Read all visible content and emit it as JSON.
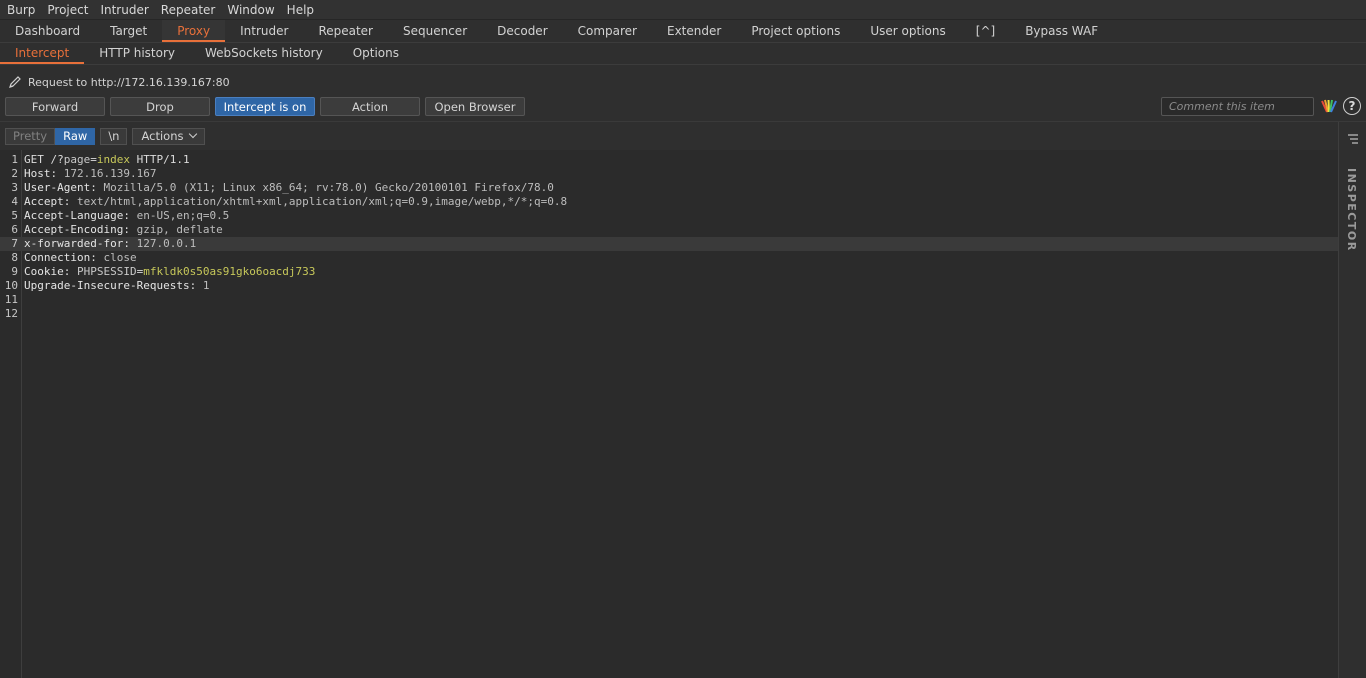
{
  "menubar": [
    "Burp",
    "Project",
    "Intruder",
    "Repeater",
    "Window",
    "Help"
  ],
  "main_tabs": [
    "Dashboard",
    "Target",
    "Proxy",
    "Intruder",
    "Repeater",
    "Sequencer",
    "Decoder",
    "Comparer",
    "Extender",
    "Project options",
    "User options",
    "[^]",
    "Bypass WAF"
  ],
  "active_main_tab": "Proxy",
  "proxy_tabs": [
    "Intercept",
    "HTTP history",
    "WebSockets history",
    "Options"
  ],
  "active_proxy_tab": "Intercept",
  "request_url": "Request to http://172.16.139.167:80",
  "buttons": {
    "forward": "Forward",
    "drop": "Drop",
    "intercept": "Intercept is on",
    "action": "Action",
    "open_browser": "Open Browser"
  },
  "comment_placeholder": "Comment this item",
  "help_glyph": "?",
  "editor_toolbar": {
    "pretty": "Pretty",
    "raw": "Raw",
    "newline": "\\n",
    "actions": "Actions"
  },
  "inspector_label": "INSPECTOR",
  "accent_color": "#e8703a",
  "primary_button_color": "#2f66a6",
  "request_lines": [
    {
      "n": "1",
      "parts": [
        [
          "plain",
          "GET /?"
        ],
        [
          "pname",
          "page"
        ],
        [
          "plain",
          "="
        ],
        [
          "pval",
          "index"
        ],
        [
          "plain",
          " HTTP/1.1"
        ]
      ]
    },
    {
      "n": "2",
      "parts": [
        [
          "hname",
          "Host"
        ],
        [
          "plain",
          ": "
        ],
        [
          "hval",
          "172.16.139.167"
        ]
      ]
    },
    {
      "n": "3",
      "parts": [
        [
          "hname",
          "User-Agent"
        ],
        [
          "plain",
          ": "
        ],
        [
          "hval",
          "Mozilla/5.0 (X11; Linux x86_64; rv:78.0) Gecko/20100101 Firefox/78.0"
        ]
      ]
    },
    {
      "n": "4",
      "parts": [
        [
          "hname",
          "Accept"
        ],
        [
          "plain",
          ": "
        ],
        [
          "hval",
          "text/html,application/xhtml+xml,application/xml;q=0.9,image/webp,*/*;q=0.8"
        ]
      ]
    },
    {
      "n": "5",
      "parts": [
        [
          "hname",
          "Accept-Language"
        ],
        [
          "plain",
          ": "
        ],
        [
          "hval",
          "en-US,en;q=0.5"
        ]
      ]
    },
    {
      "n": "6",
      "parts": [
        [
          "hname",
          "Accept-Encoding"
        ],
        [
          "plain",
          ": "
        ],
        [
          "hval",
          "gzip, deflate"
        ]
      ]
    },
    {
      "n": "7",
      "parts": [
        [
          "hname",
          "x-forwarded-for"
        ],
        [
          "plain",
          ": "
        ],
        [
          "hval",
          "127.0.0.1"
        ]
      ],
      "highlight": true
    },
    {
      "n": "8",
      "parts": [
        [
          "hname",
          "Connection"
        ],
        [
          "plain",
          ": "
        ],
        [
          "hval",
          "close"
        ]
      ]
    },
    {
      "n": "9",
      "parts": [
        [
          "hname",
          "Cookie"
        ],
        [
          "plain",
          ": "
        ],
        [
          "pname",
          "PHPSESSID"
        ],
        [
          "plain",
          "="
        ],
        [
          "pval",
          "mfkldk0s50as91gko6oacdj733"
        ]
      ]
    },
    {
      "n": "10",
      "parts": [
        [
          "hname",
          "Upgrade-Insecure-Requests"
        ],
        [
          "plain",
          ": "
        ],
        [
          "hval",
          "1"
        ]
      ]
    },
    {
      "n": "11",
      "parts": []
    },
    {
      "n": "12",
      "parts": []
    }
  ]
}
